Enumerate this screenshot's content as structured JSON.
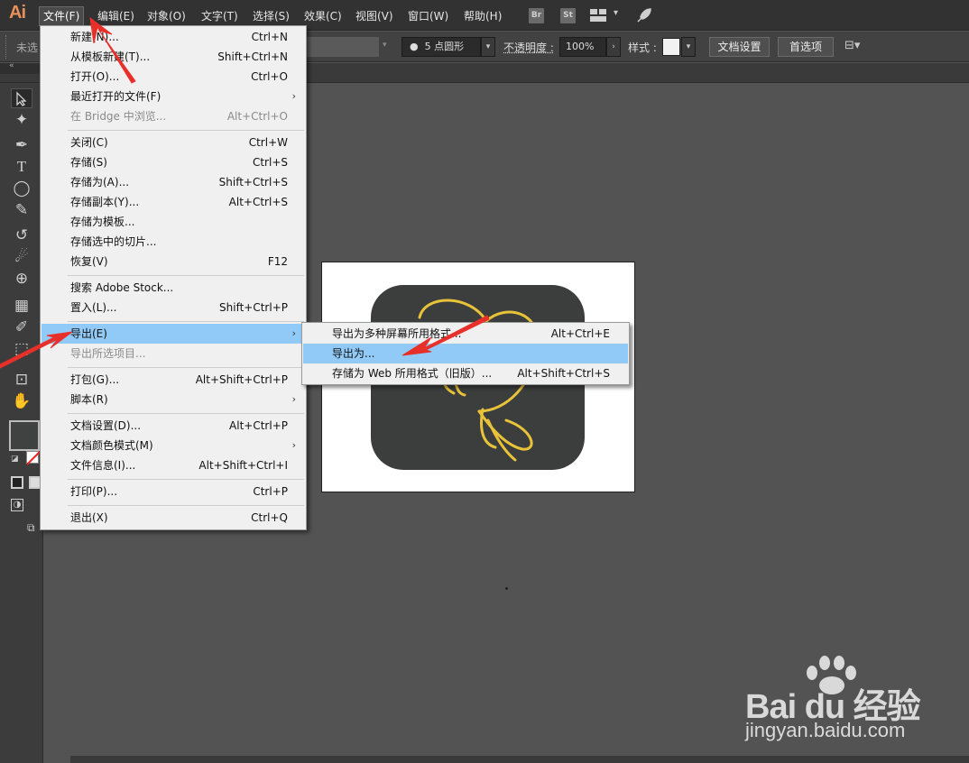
{
  "app": {
    "logo": "Ai"
  },
  "menubar": {
    "items": [
      "文件(F)",
      "编辑(E)",
      "对象(O)",
      "文字(T)",
      "选择(S)",
      "效果(C)",
      "视图(V)",
      "窗口(W)",
      "帮助(H)"
    ],
    "br": "Br",
    "st": "St"
  },
  "controlbar": {
    "no_selection": "未选",
    "stroke_profile": "5 点圆形",
    "opacity_label": "不透明度 :",
    "opacity_value": "100%",
    "style_label": "样式 :",
    "doc_setup": "文档设置",
    "preferences": "首选项"
  },
  "file_menu": {
    "new": {
      "label": "新建(N)...",
      "shortcut": "Ctrl+N"
    },
    "new_from_template": {
      "label": "从模板新建(T)...",
      "shortcut": "Shift+Ctrl+N"
    },
    "open": {
      "label": "打开(O)...",
      "shortcut": "Ctrl+O"
    },
    "recent": {
      "label": "最近打开的文件(F)"
    },
    "bridge": {
      "label": "在 Bridge 中浏览...",
      "shortcut": "Alt+Ctrl+O"
    },
    "close": {
      "label": "关闭(C)",
      "shortcut": "Ctrl+W"
    },
    "save": {
      "label": "存储(S)",
      "shortcut": "Ctrl+S"
    },
    "save_as": {
      "label": "存储为(A)...",
      "shortcut": "Shift+Ctrl+S"
    },
    "save_copy": {
      "label": "存储副本(Y)...",
      "shortcut": "Alt+Ctrl+S"
    },
    "save_template": {
      "label": "存储为模板..."
    },
    "save_slices": {
      "label": "存储选中的切片..."
    },
    "revert": {
      "label": "恢复(V)",
      "shortcut": "F12"
    },
    "search_stock": {
      "label": "搜索 Adobe Stock..."
    },
    "place": {
      "label": "置入(L)...",
      "shortcut": "Shift+Ctrl+P"
    },
    "export": {
      "label": "导出(E)"
    },
    "export_selection": {
      "label": "导出所选项目..."
    },
    "package": {
      "label": "打包(G)...",
      "shortcut": "Alt+Shift+Ctrl+P"
    },
    "scripts": {
      "label": "脚本(R)"
    },
    "doc_setup": {
      "label": "文档设置(D)...",
      "shortcut": "Alt+Ctrl+P"
    },
    "color_mode": {
      "label": "文档颜色模式(M)"
    },
    "file_info": {
      "label": "文件信息(I)...",
      "shortcut": "Alt+Shift+Ctrl+I"
    },
    "print": {
      "label": "打印(P)...",
      "shortcut": "Ctrl+P"
    },
    "exit": {
      "label": "退出(X)",
      "shortcut": "Ctrl+Q"
    }
  },
  "export_submenu": {
    "screens": {
      "label": "导出为多种屏幕所用格式...",
      "shortcut": "Alt+Ctrl+E"
    },
    "export_as": {
      "label": "导出为..."
    },
    "save_web": {
      "label": "存储为 Web 所用格式（旧版）...",
      "shortcut": "Alt+Shift+Ctrl+S"
    }
  },
  "watermark": {
    "brand": "Bai du 经验",
    "url": "jingyan.baidu.com"
  },
  "colors": {
    "menu_highlight": "#91c9f7",
    "annotation_arrow": "#e8302a",
    "icon_stroke": "#e8c33a",
    "app_accent": "#e8905a"
  }
}
